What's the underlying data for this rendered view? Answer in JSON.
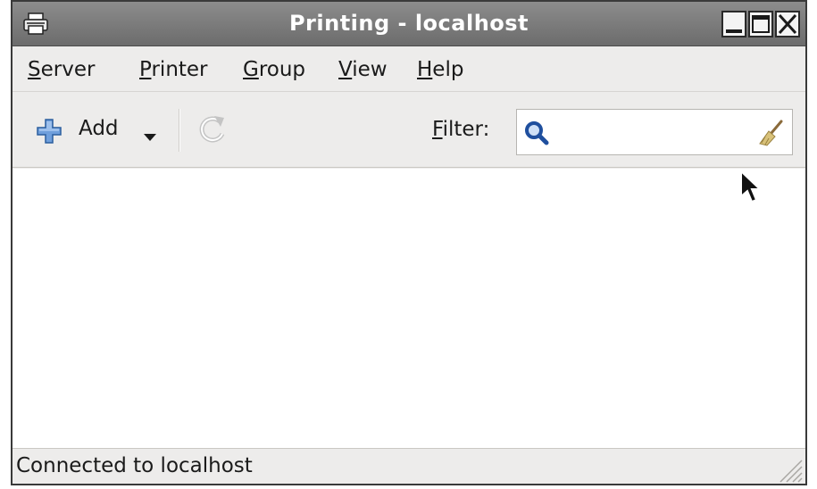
{
  "window": {
    "title": "Printing - localhost"
  },
  "menubar": {
    "items": [
      {
        "mnemonic": "S",
        "rest": "erver"
      },
      {
        "mnemonic": "P",
        "rest": "rinter"
      },
      {
        "mnemonic": "G",
        "rest": "roup"
      },
      {
        "mnemonic": "V",
        "rest": "iew"
      },
      {
        "mnemonic": "H",
        "rest": "elp"
      }
    ]
  },
  "toolbar": {
    "add_label": "Add",
    "add_icon": "plus-icon",
    "refresh_icon": "refresh-icon",
    "filter_mnemonic": "F",
    "filter_rest": "ilter:",
    "filter_value": "",
    "search_icon": "magnifier-icon",
    "clear_icon": "broom-icon"
  },
  "statusbar": {
    "text": "Connected to localhost"
  },
  "colors": {
    "titlebar": "#7c7c7c",
    "window_bg": "#edeceb",
    "accent_blue": "#3a6fb7"
  }
}
